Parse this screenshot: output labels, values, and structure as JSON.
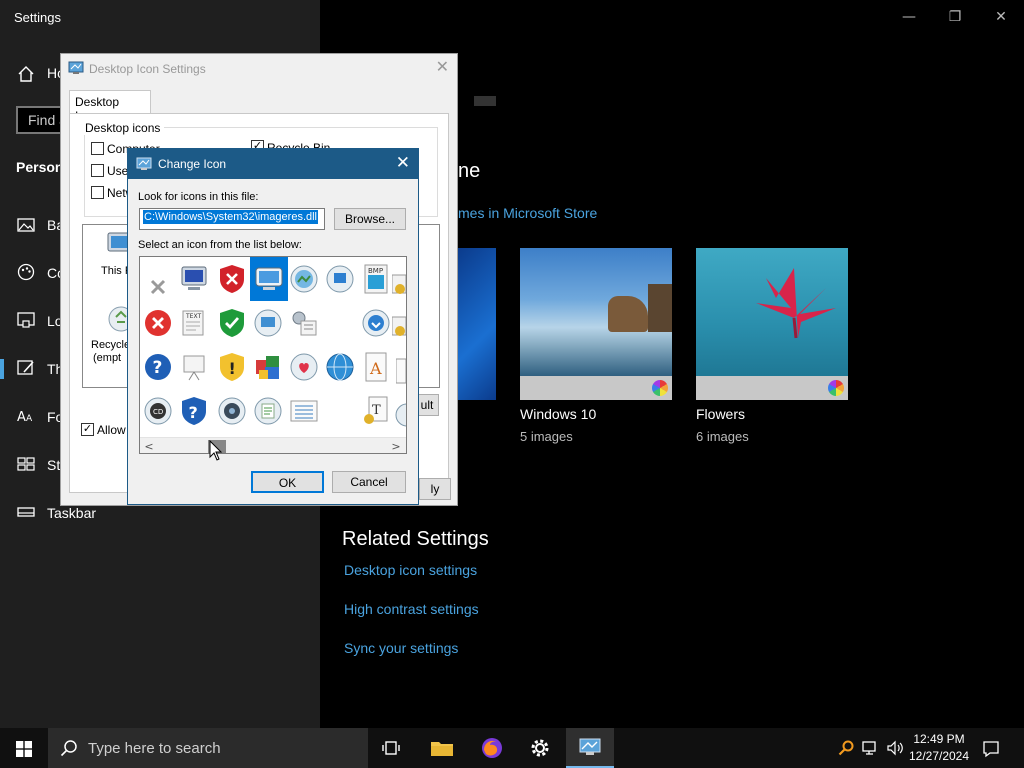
{
  "settings": {
    "app_title": "Settings",
    "window_controls": {
      "minimize": "—",
      "restore": "❐",
      "close": "✕"
    },
    "nav_home": "Ho",
    "find_placeholder": "Find a",
    "section_header": "Person",
    "nav_items": [
      {
        "label": "Ba",
        "icon": "image-icon"
      },
      {
        "label": "Co",
        "icon": "palette-icon"
      },
      {
        "label": "Lo",
        "icon": "lock-screen-icon"
      },
      {
        "label": "Th",
        "icon": "themes-icon"
      },
      {
        "label": "Fo",
        "icon": "fonts-icon"
      },
      {
        "label": "Sta",
        "icon": "start-icon"
      },
      {
        "label": "Taskbar",
        "icon": "taskbar-icon"
      }
    ],
    "themes_heading_partial": "ne",
    "store_link_partial": "mes in Microsoft Store",
    "themes": [
      {
        "name": "Windows 10",
        "count": "5 images"
      },
      {
        "name": "Flowers",
        "count": "6 images"
      }
    ],
    "related_heading": "Related Settings",
    "related_links": [
      "Desktop icon settings",
      "High contrast settings",
      "Sync your settings"
    ]
  },
  "desktop_icon_settings": {
    "title": "Desktop Icon Settings",
    "close": "✕",
    "tab": "Desktop Icons",
    "group_label": "Desktop icons",
    "checkboxes": [
      {
        "label": "Computer",
        "checked": false
      },
      {
        "label": "User",
        "checked": false
      },
      {
        "label": "Netw",
        "checked": false
      },
      {
        "label": "Recycle Bin",
        "checked": true
      }
    ],
    "list_labels": [
      "This P",
      "Recycle",
      "(empt"
    ],
    "allow_label": "Allow t",
    "restore_button_partial": "ult",
    "apply_button_partial": "ly"
  },
  "change_icon": {
    "title": "Change Icon",
    "close": "✕",
    "look_label": "Look for icons in this file:",
    "file_path": "C:\\Windows\\System32\\imageres.dll",
    "browse_label": "Browse...",
    "select_label": "Select an icon from the list below:",
    "ok_label": "OK",
    "cancel_label": "Cancel",
    "scroll_left": "<",
    "scroll_right": ">",
    "selected_icon_index": 3
  },
  "taskbar": {
    "search_placeholder": "Type here to search",
    "time": "12:49 PM",
    "date": "12/27/2024"
  },
  "colors": {
    "accent": "#0078d7",
    "dialog_titlebar": "#1c5a87",
    "link": "#4aa3df"
  }
}
